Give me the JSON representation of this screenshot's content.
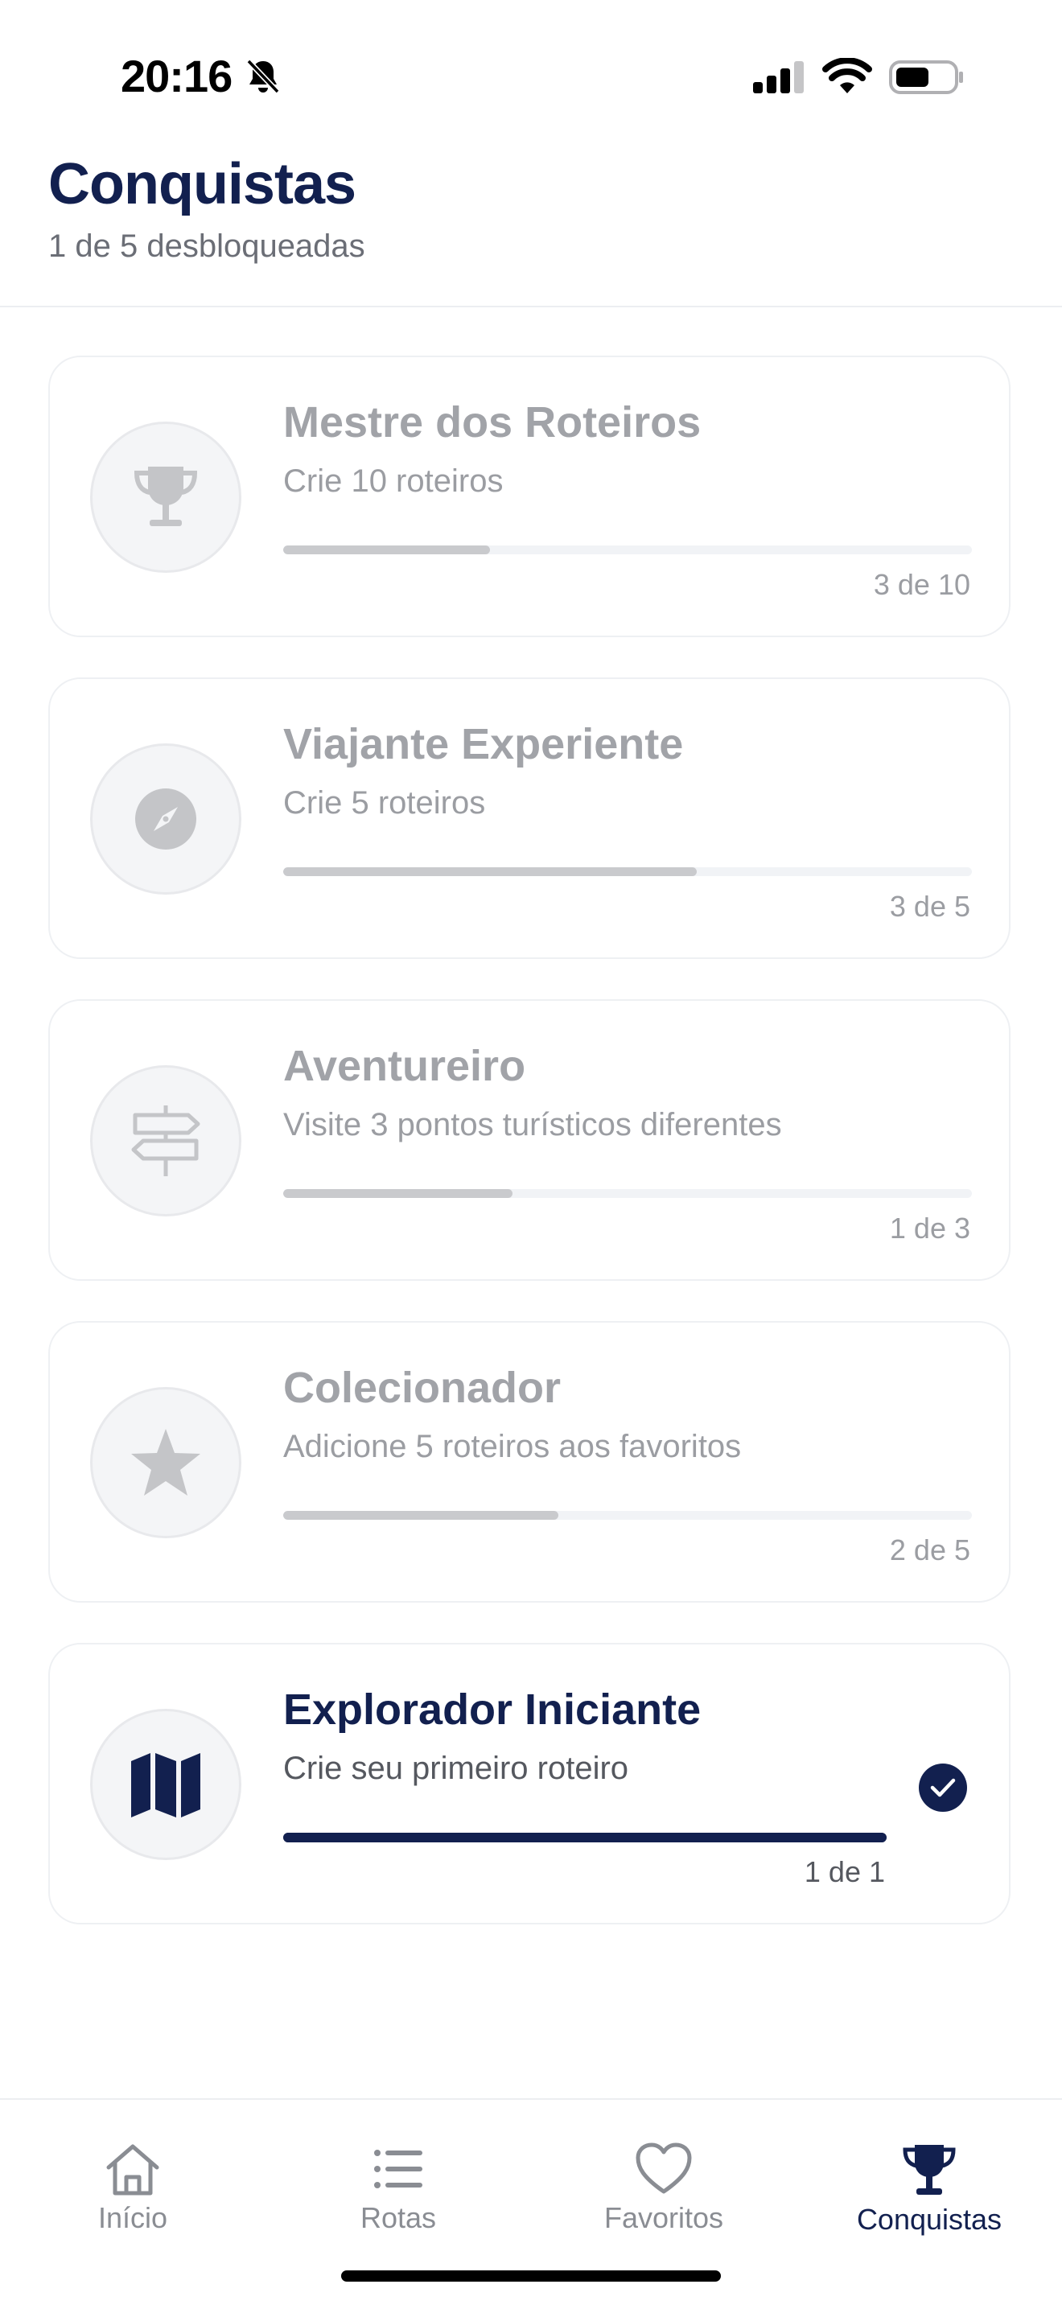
{
  "status_bar": {
    "time": "20:16",
    "icons": [
      "bell-slash-icon",
      "signal-icon",
      "wifi-icon",
      "battery-icon"
    ]
  },
  "header": {
    "title": "Conquistas",
    "subtitle": "1 de 5 desbloqueadas"
  },
  "achievements": [
    {
      "title": "Mestre dos Roteiros",
      "description": "Crie 10 roteiros",
      "progress_text": "3 de 10",
      "progress": 0.3,
      "icon": "trophy-icon",
      "unlocked": false
    },
    {
      "title": "Viajante Experiente",
      "description": "Crie 5 roteiros",
      "progress_text": "3 de 5",
      "progress": 0.6,
      "icon": "compass-icon",
      "unlocked": false
    },
    {
      "title": "Aventureiro",
      "description": "Visite 3 pontos turísticos diferentes",
      "progress_text": "1 de 3",
      "progress": 0.333,
      "icon": "signpost-icon",
      "unlocked": false
    },
    {
      "title": "Colecionador",
      "description": "Adicione 5 roteiros aos favoritos",
      "progress_text": "2 de 5",
      "progress": 0.4,
      "icon": "star-icon",
      "unlocked": false
    },
    {
      "title": "Explorador Iniciante",
      "description": "Crie seu primeiro roteiro",
      "progress_text": "1 de 1",
      "progress": 1.0,
      "icon": "map-icon",
      "unlocked": true
    }
  ],
  "tabs": [
    {
      "label": "Início",
      "icon": "home-icon",
      "active": false
    },
    {
      "label": "Rotas",
      "icon": "list-icon",
      "active": false
    },
    {
      "label": "Favoritos",
      "icon": "heart-icon",
      "active": false
    },
    {
      "label": "Conquistas",
      "icon": "trophy-icon",
      "active": true
    }
  ],
  "colors": {
    "primary": "#12204f",
    "locked_text": "#a1a3a8",
    "locked_fill": "#c9cacd",
    "track": "#f1f3f6"
  }
}
